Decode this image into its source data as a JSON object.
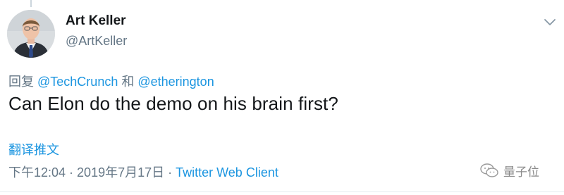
{
  "author": {
    "display_name": "Art Keller",
    "handle": "@ArtKeller"
  },
  "reply": {
    "prefix": "回复 ",
    "mention_1": "@TechCrunch",
    "joiner": " 和 ",
    "mention_2": "@etherington"
  },
  "tweet": {
    "text": "Can Elon do the demo on his brain first?"
  },
  "translate_label": "翻译推文",
  "meta": {
    "time": "下午12:04",
    "separator": " · ",
    "date": "2019年7月17日",
    "separator_2": " · ",
    "source": "Twitter Web Client"
  },
  "watermark": {
    "text": "量子位"
  },
  "colors": {
    "link": "#1b95e0",
    "muted": "#657786",
    "text": "#14171a"
  }
}
